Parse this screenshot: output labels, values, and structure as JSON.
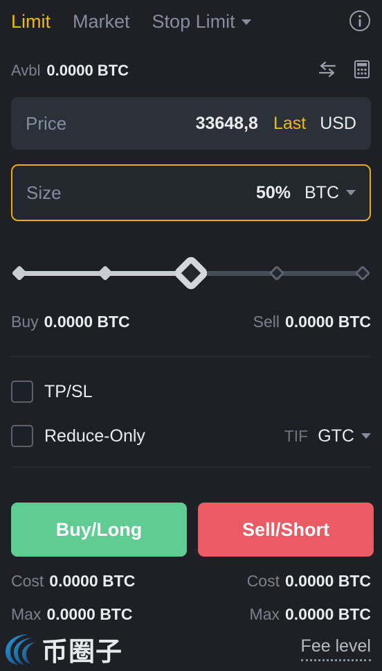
{
  "order_form": {
    "tabs": [
      {
        "label": "Limit",
        "active": true,
        "has_caret": false
      },
      {
        "label": "Market",
        "active": false,
        "has_caret": false
      },
      {
        "label": "Stop Limit",
        "active": false,
        "has_caret": true
      }
    ],
    "info_icon": "info-circle-icon",
    "balance": {
      "label": "Avbl",
      "value": "0.0000 BTC",
      "swap_icon": "swap-arrows-icon",
      "calculator_icon": "calculator-icon"
    },
    "price_field": {
      "placeholder": "Price",
      "value": "33648,8",
      "mode_label": "Last",
      "unit": "USD"
    },
    "size_field": {
      "placeholder": "Size",
      "percent": "50%",
      "unit": "BTC"
    },
    "slider": {
      "value": 50,
      "ticks": [
        0,
        25,
        50,
        75,
        100
      ]
    },
    "amounts": {
      "buy_label": "Buy",
      "buy_value": "0.0000 BTC",
      "sell_label": "Sell",
      "sell_value": "0.0000 BTC"
    },
    "options": {
      "tpsl_label": "TP/SL",
      "tpsl_checked": false,
      "reduce_only_label": "Reduce-Only",
      "reduce_only_checked": false,
      "tif_label": "TIF",
      "tif_value": "GTC"
    },
    "actions": {
      "buy_label": "Buy/Long",
      "sell_label": "Sell/Short"
    },
    "stats": {
      "buy_cost_label": "Cost",
      "buy_cost_value": "0.0000 BTC",
      "sell_cost_label": "Cost",
      "sell_cost_value": "0.0000 BTC",
      "buy_max_label": "Max",
      "buy_max_value": "0.0000 BTC",
      "sell_max_label": "Max",
      "sell_max_value": "0.0000 BTC"
    },
    "footer": {
      "watermark_text": "币圈子",
      "watermark_logo": "swirl-logo-icon",
      "fee_level_label": "Fee level"
    },
    "colors": {
      "accent": "#f0b90b",
      "buy_green": "#5fcd91",
      "sell_red": "#eb5b63",
      "page_bg": "#1e2026",
      "field_bg": "#2b3139",
      "muted_text": "#848e9c"
    }
  }
}
